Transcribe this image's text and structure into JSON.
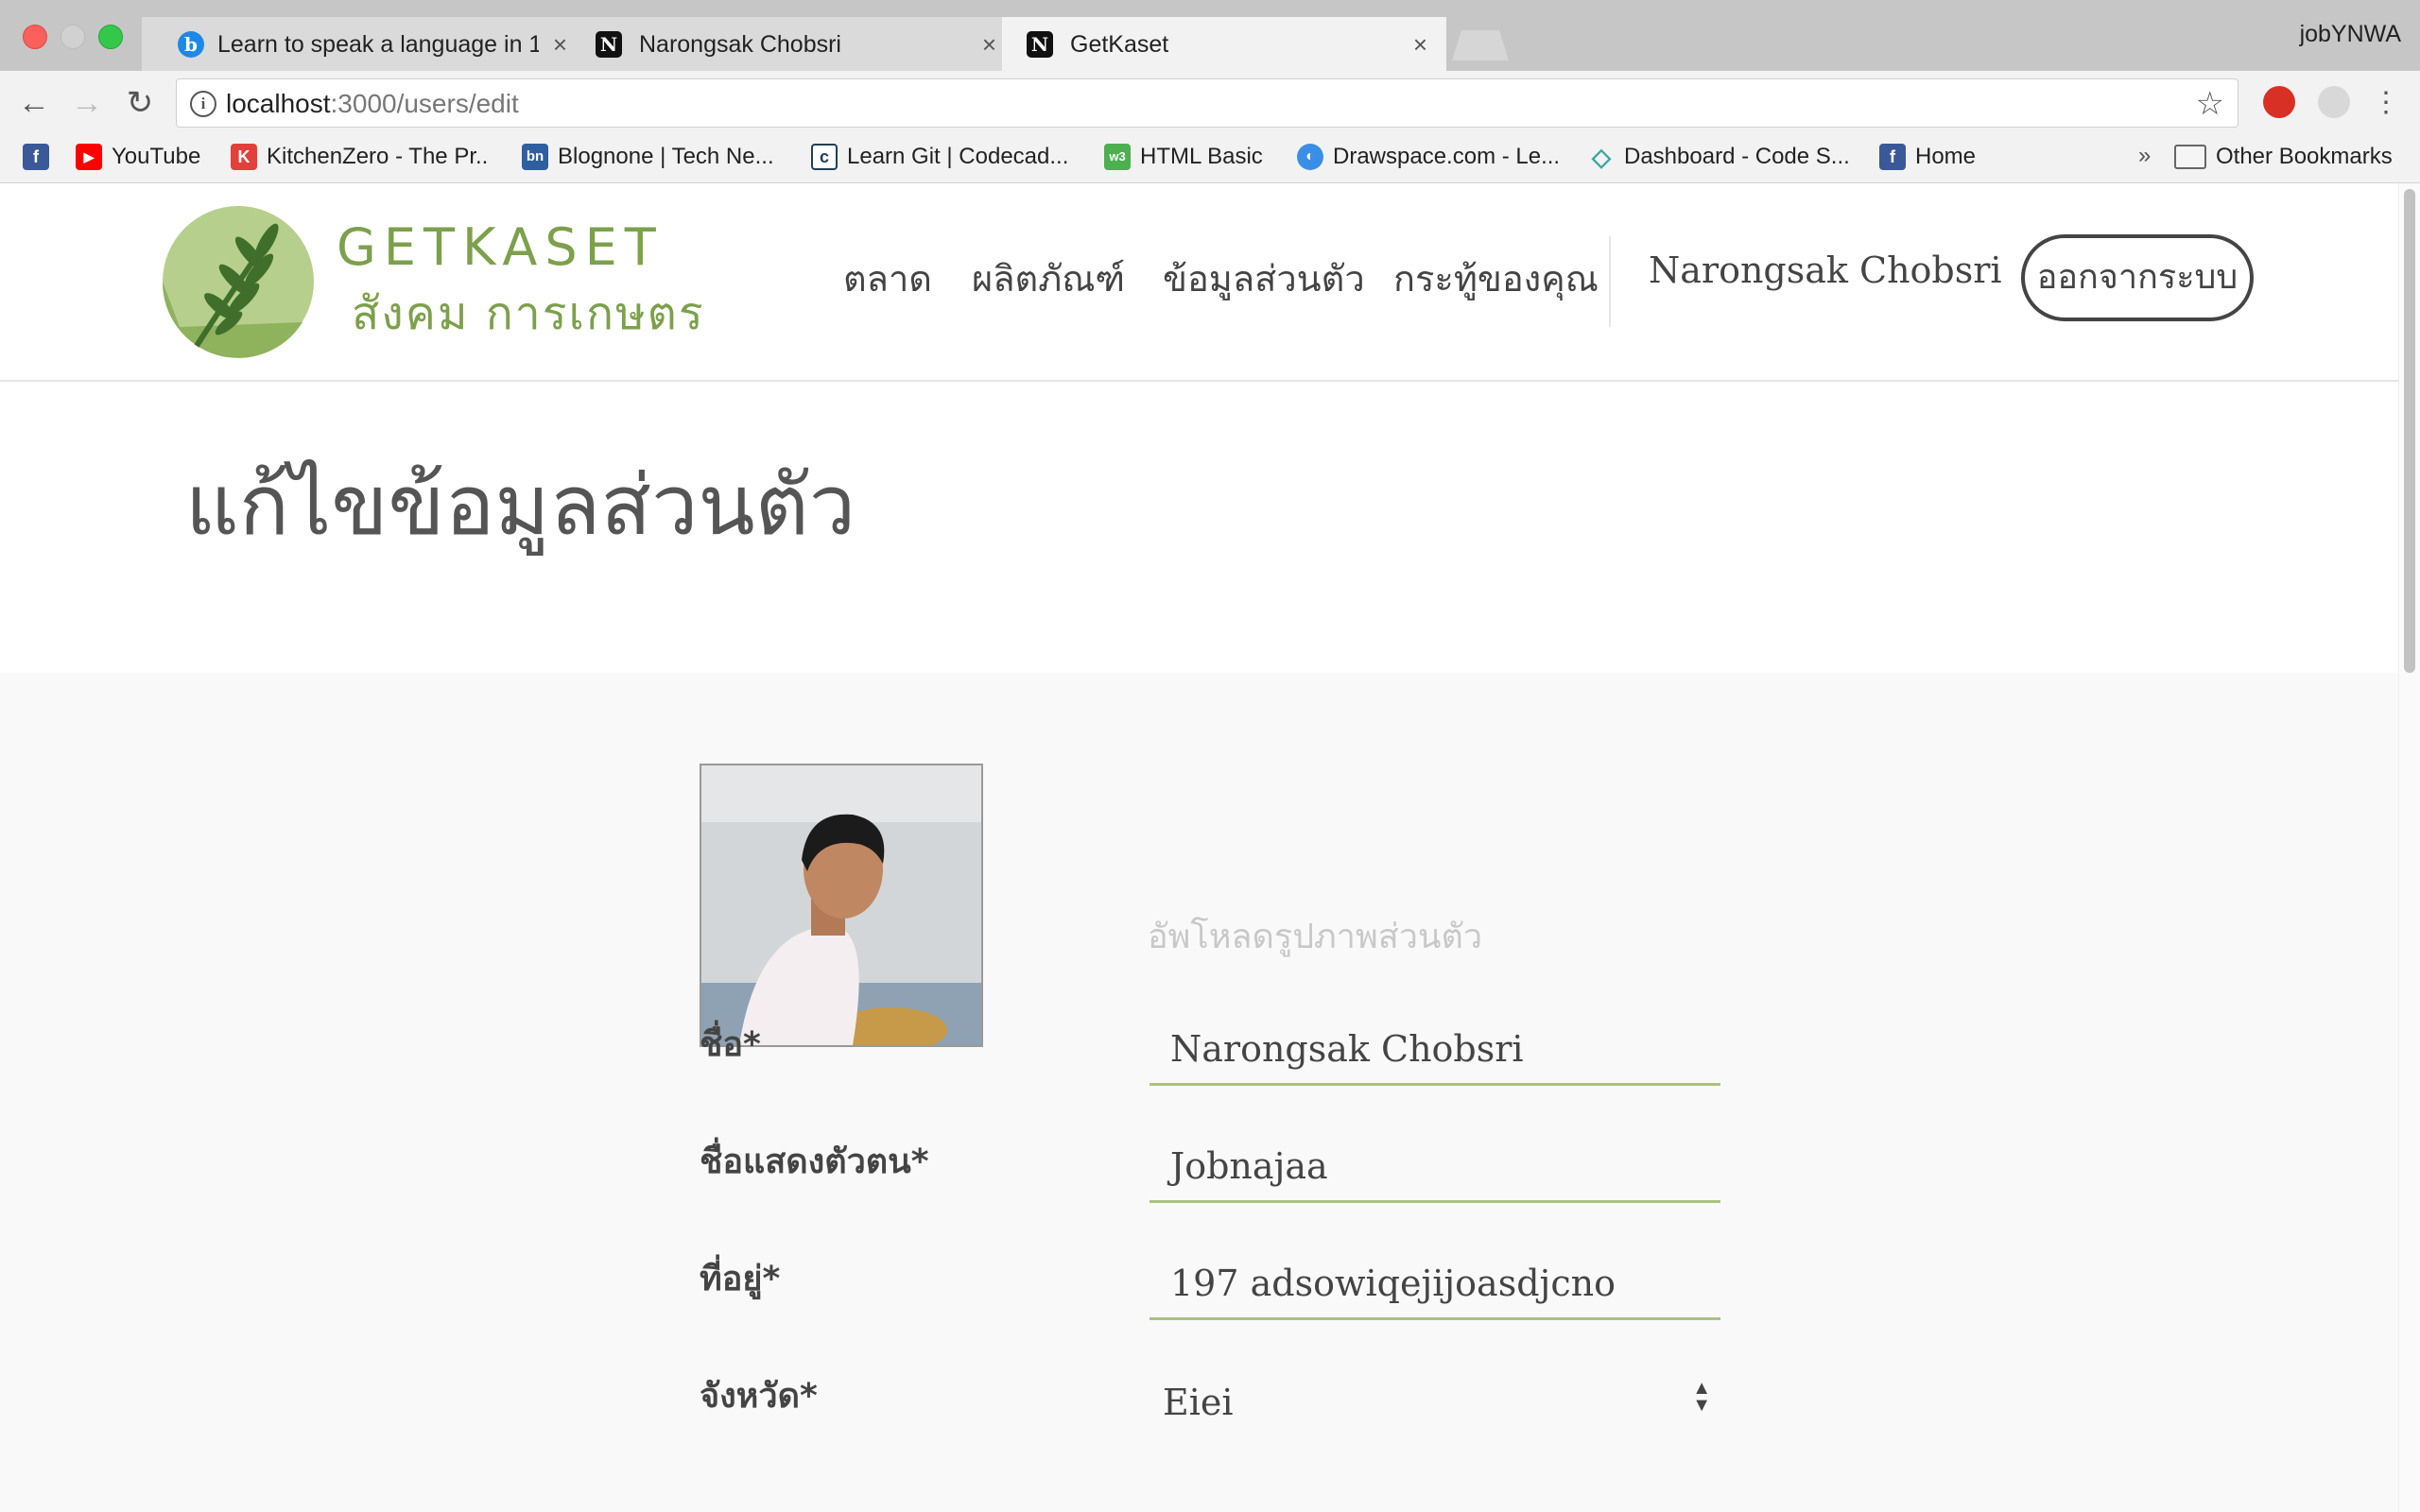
{
  "browser": {
    "tabs": [
      {
        "title": "Learn to speak a language in 10",
        "icon": "bing-b-icon",
        "active": false
      },
      {
        "title": "Narongsak Chobsri",
        "icon": "n-favicon-icon",
        "active": false
      },
      {
        "title": "GetKaset",
        "icon": "n-favicon-icon",
        "active": true
      }
    ],
    "tab_close": "×",
    "profile_name": "jobYNWA",
    "url_host": "localhost",
    "url_path": ":3000/users/edit",
    "info_glyph": "i",
    "bookmarks": [
      {
        "label": "",
        "icon": "facebook-icon",
        "glyph": "f",
        "color": "#3b5998"
      },
      {
        "label": "YouTube",
        "icon": "youtube-icon",
        "glyph": "▶",
        "color": "#ff0000"
      },
      {
        "label": "KitchenZero - The Pr..",
        "icon": "kitchenzero-icon",
        "glyph": "K",
        "color": "#e2403a"
      },
      {
        "label": "Blognone | Tech Ne...",
        "icon": "blognone-icon",
        "glyph": "bn",
        "color": "#2f5f9e"
      },
      {
        "label": "Learn Git | Codecad...",
        "icon": "codecademy-icon",
        "glyph": "c",
        "color": "#1f4056"
      },
      {
        "label": "HTML Basic",
        "icon": "w3schools-icon",
        "glyph": "w3",
        "color": "#4caf50"
      },
      {
        "label": "Drawspace.com - Le...",
        "icon": "drawspace-icon",
        "glyph": "◐",
        "color": "#3a8ee6"
      },
      {
        "label": "Dashboard - Code S...",
        "icon": "codeschool-icon",
        "glyph": "◇",
        "color": "#3aa6a4"
      },
      {
        "label": "Home",
        "icon": "facebook-icon",
        "glyph": "f",
        "color": "#3b5998"
      }
    ],
    "bookmarks_more": "»",
    "other_bookmarks": "Other Bookmarks"
  },
  "site": {
    "logo_main": "GETKASET",
    "logo_sub": "สังคม การเกษตร",
    "nav": [
      "ตลาด",
      "ผลิตภัณฑ์",
      "ข้อมูลส่วนตัว",
      "กระทู้ของคุณ"
    ],
    "user_name": "Narongsak Chobsri",
    "logout_label": "ออกจากระบบ",
    "colors": {
      "brand_green": "#7da04c",
      "underline_green": "#a9c380"
    }
  },
  "page": {
    "title": "แก้ไขข้อมูลส่วนตัว",
    "upload_label": "อัพโหลดรูปภาพส่วนตัว",
    "fields": [
      {
        "label": "ชื่อ*",
        "value": "Narongsak Chobsri"
      },
      {
        "label": "ชื่อแสดงตัวตน*",
        "value": "Jobnajaa"
      },
      {
        "label": "ที่อยู่*",
        "value": "197 adsowiqejijoasdjcno"
      }
    ],
    "province": {
      "label": "จังหวัด*",
      "value": "Eiei"
    }
  }
}
